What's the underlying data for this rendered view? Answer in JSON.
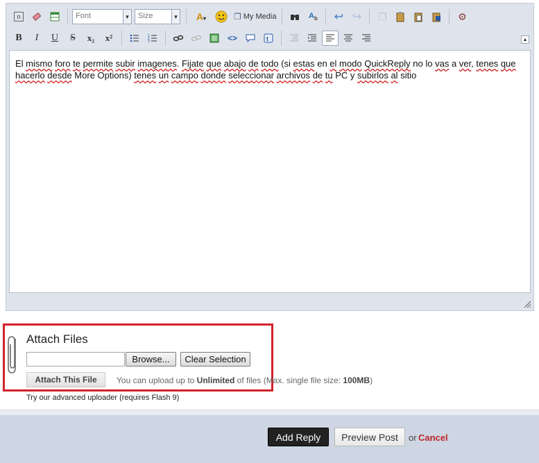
{
  "toolbar": {
    "row1": {
      "font_select": "Font",
      "size_select": "Size",
      "my_media_label": "My Media"
    },
    "row2": {
      "bold": "B",
      "italic": "I",
      "underline": "U",
      "strike": "S",
      "subscript": "x₂",
      "superscript": "x²"
    }
  },
  "editor": {
    "text_segments": [
      {
        "t": "El ",
        "w": false
      },
      {
        "t": "mismo",
        "w": true
      },
      {
        "t": " ",
        "w": false
      },
      {
        "t": "foro",
        "w": true
      },
      {
        "t": " ",
        "w": false
      },
      {
        "t": "te",
        "w": true
      },
      {
        "t": " ",
        "w": false
      },
      {
        "t": "permite",
        "w": true
      },
      {
        "t": " ",
        "w": false
      },
      {
        "t": "subir",
        "w": true
      },
      {
        "t": " ",
        "w": false
      },
      {
        "t": "imagenes",
        "w": true
      },
      {
        "t": ".  ",
        "w": false
      },
      {
        "t": "Fijate",
        "w": true
      },
      {
        "t": " ",
        "w": false
      },
      {
        "t": "que",
        "w": true
      },
      {
        "t": " ",
        "w": false
      },
      {
        "t": "abajo",
        "w": true
      },
      {
        "t": " ",
        "w": false
      },
      {
        "t": "de",
        "w": true
      },
      {
        "t": " ",
        "w": false
      },
      {
        "t": "todo",
        "w": true
      },
      {
        "t": " (si ",
        "w": false
      },
      {
        "t": "estas",
        "w": true
      },
      {
        "t": " en ",
        "w": false
      },
      {
        "t": "el",
        "w": true
      },
      {
        "t": " ",
        "w": false
      },
      {
        "t": "modo",
        "w": true
      },
      {
        "t": " ",
        "w": false
      },
      {
        "t": "QuickReply",
        "w": true
      },
      {
        "t": " no lo ",
        "w": false
      },
      {
        "t": "vas",
        "w": true
      },
      {
        "t": " a ",
        "w": false
      },
      {
        "t": "ver",
        "w": true
      },
      {
        "t": ", ",
        "w": false
      },
      {
        "t": "tenes",
        "w": true
      },
      {
        "t": " ",
        "w": false
      },
      {
        "t": "que",
        "w": true
      },
      {
        "t": " ",
        "w": false
      },
      {
        "t": "hacerlo",
        "w": true
      },
      {
        "t": " ",
        "w": false
      },
      {
        "t": "desde",
        "w": true
      },
      {
        "t": " More Options)  ",
        "w": false
      },
      {
        "t": "tenes",
        "w": true
      },
      {
        "t": " ",
        "w": false
      },
      {
        "t": "un",
        "w": true
      },
      {
        "t": " ",
        "w": false
      },
      {
        "t": "campo",
        "w": true
      },
      {
        "t": " ",
        "w": false
      },
      {
        "t": "donde",
        "w": true
      },
      {
        "t": " ",
        "w": false
      },
      {
        "t": "seleccionar",
        "w": true
      },
      {
        "t": " ",
        "w": false
      },
      {
        "t": "archivos",
        "w": true
      },
      {
        "t": " ",
        "w": false
      },
      {
        "t": "de",
        "w": true
      },
      {
        "t": " ",
        "w": false
      },
      {
        "t": "tu",
        "w": true
      },
      {
        "t": " PC y ",
        "w": false
      },
      {
        "t": "subirlos",
        "w": true
      },
      {
        "t": " ",
        "w": false
      },
      {
        "t": "al",
        "w": true
      },
      {
        "t": " sitio",
        "w": false
      }
    ]
  },
  "attach": {
    "title": "Attach Files",
    "browse_label": "Browse...",
    "clear_label": "Clear Selection",
    "attach_this_label": "Attach This File",
    "upload_prefix": "You can upload up to ",
    "upload_limit": "Unlimited",
    "upload_mid": " of files (Max. single file size: ",
    "upload_size": "100MB",
    "upload_suffix": ")",
    "advanced_link": "Try our advanced uploader (requires Flash 9)"
  },
  "footer": {
    "add_reply_label": "Add Reply",
    "preview_label": "Preview Post",
    "or_text": "or",
    "cancel_label": "Cancel"
  },
  "colors": {
    "highlight_box": "#d1232a",
    "cancel": "#c0262c",
    "footer_bg": "#cdd6e2"
  }
}
